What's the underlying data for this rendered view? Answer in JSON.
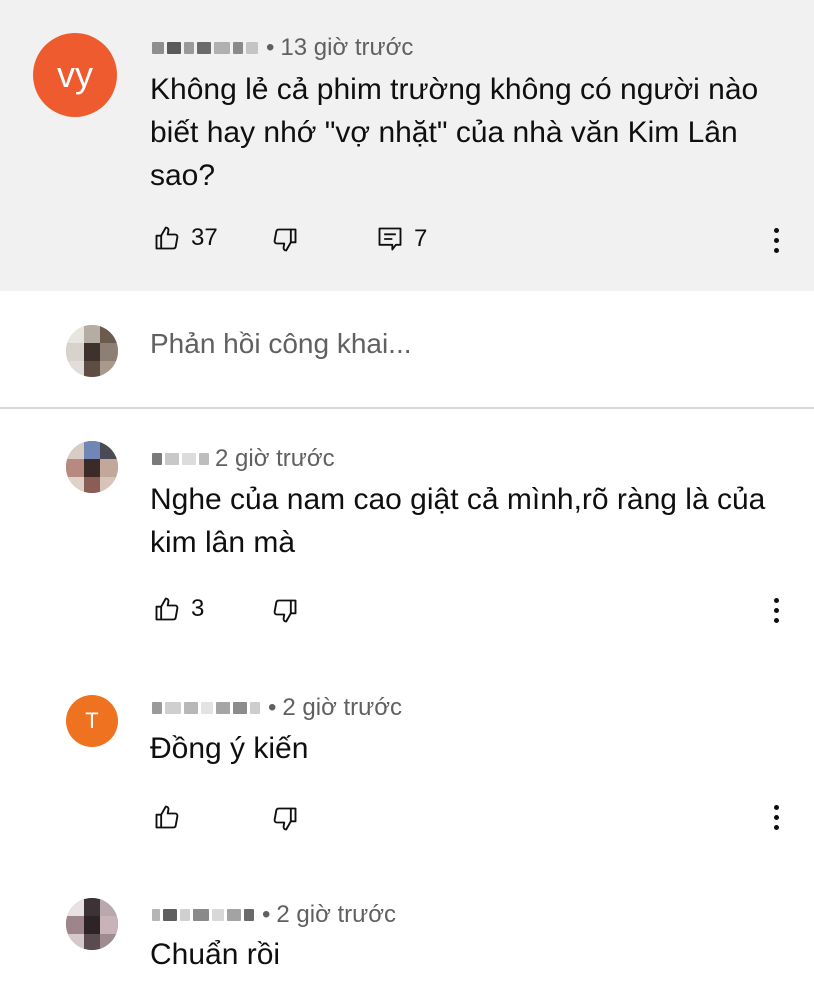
{
  "comments": [
    {
      "avatar_letter": "vy",
      "avatar_color": "#ed5b2f",
      "time": "13 giờ trước",
      "text": "Không lẻ cả phim trường không có người nào biết hay nhớ \"vợ nhặt\"  của nhà văn Kim Lân sao?",
      "likes": "37",
      "replies": "7"
    },
    {
      "time": "2 giờ trước",
      "text": "Nghe của nam cao giật cả mình,rõ ràng là của kim lân mà",
      "likes": "3"
    },
    {
      "avatar_letter": "T",
      "avatar_color": "#ee7220",
      "time": "2 giờ trước",
      "text": "Đồng ý kiến"
    },
    {
      "time": "2 giờ trước",
      "text": "Chuẩn rồi"
    }
  ],
  "reply_box": {
    "placeholder": "Phản hồi công khai..."
  },
  "icons": {
    "like": "thumbs-up-icon",
    "dislike": "thumbs-down-icon",
    "reply": "comment-icon",
    "menu": "more-vert-icon"
  }
}
